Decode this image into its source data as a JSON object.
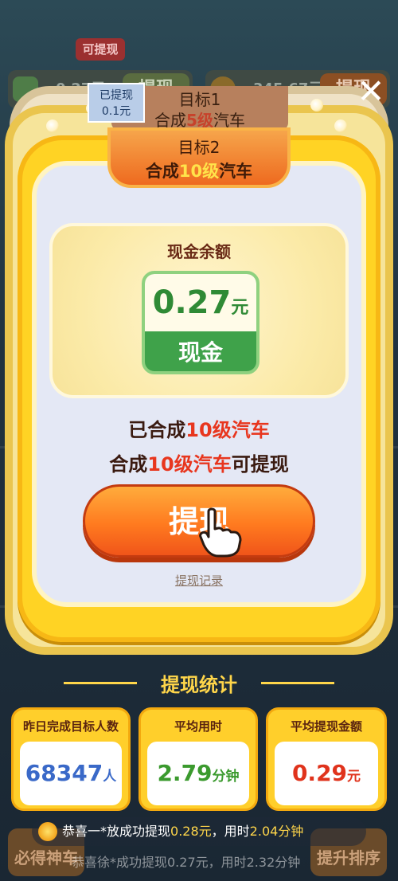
{
  "background": {
    "withdrawable_tag": "可提现",
    "wallet_left_amount": "0.27元",
    "wallet_left_button": "提现",
    "wallet_right_amount": "345.67元",
    "wallet_right_button": "提现",
    "bottom_left_button": "必得神车",
    "bottom_right_button": "提升排序"
  },
  "close_label": "✕",
  "goal1": {
    "title": "目标1",
    "desc_prefix": "合成",
    "desc_highlight": "5级",
    "desc_suffix": "汽车",
    "badge_line1": "已提现",
    "badge_line2": "0.1元"
  },
  "goal2": {
    "title": "目标2",
    "desc_prefix": "合成",
    "desc_highlight": "10级",
    "desc_suffix": "汽车"
  },
  "balance": {
    "title": "现金余额",
    "amount": "0.27",
    "unit": "元",
    "type_label": "现金"
  },
  "status": {
    "line1_prefix": "已合成",
    "line1_highlight": "10级汽车",
    "line2_prefix": "合成",
    "line2_highlight": "10级汽车",
    "line2_suffix": "可提现"
  },
  "withdraw_button": "提现",
  "history_link": "提现记录",
  "stats": {
    "title": "提现统计",
    "cards": [
      {
        "label": "昨日完成目标人数",
        "value": "68347",
        "unit": "人"
      },
      {
        "label": "平均用时",
        "value": "2.79",
        "unit": "分钟"
      },
      {
        "label": "平均提现金额",
        "value": "0.29",
        "unit": "元"
      }
    ]
  },
  "ticker": {
    "prefix": "恭喜一*放成功提现",
    "amount": "0.28元",
    "middle": "，用时",
    "time": "2.04分钟",
    "second_line": "恭喜徐*成功提现0.27元，用时2.32分钟"
  },
  "colors": {
    "card_yellow": "#ffd324",
    "accent_orange": "#ff7a1f",
    "highlight_red": "#e8361e",
    "cash_green": "#3fa24a"
  }
}
